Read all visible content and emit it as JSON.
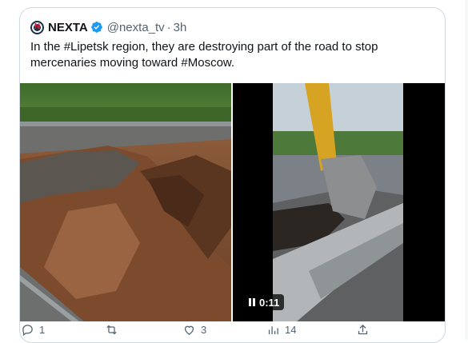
{
  "tweet": {
    "display_name": "NEXTA",
    "handle": "@nexta_tv",
    "separator": "·",
    "time": "3h",
    "text": "In the #Lipetsk region, they are destroying part of the road to stop mercenaries moving toward #Moscow.",
    "avatar_letter": "N",
    "colors": {
      "verified": "#1d9bf0",
      "text": "#0f1419",
      "muted": "#536471",
      "border": "#cfd9de"
    }
  },
  "media": {
    "left": {
      "alt_icon": "road-excavation-photo"
    },
    "right": {
      "duration": "0:11",
      "control_icon": "pause-icon"
    }
  },
  "actions": {
    "reply_count": "1",
    "retweet_count": "",
    "like_count": "3",
    "views_count": "14",
    "share_count": ""
  }
}
